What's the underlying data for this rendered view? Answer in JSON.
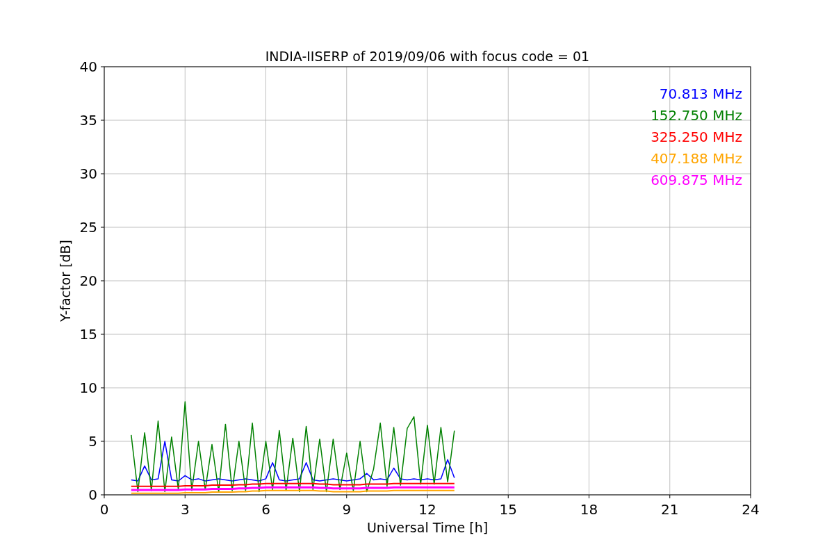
{
  "figure": {
    "chart_data": {
      "type": "line",
      "title": "INDIA-IISERP of 2019/09/06 with focus code = 01",
      "xlabel": "Universal Time [h]",
      "ylabel": "Y-factor [dB]",
      "x": [
        1,
        1.25,
        1.5,
        1.75,
        2,
        2.25,
        2.5,
        2.75,
        3,
        3.25,
        3.5,
        3.75,
        4,
        4.25,
        4.5,
        4.75,
        5,
        5.25,
        5.5,
        5.75,
        6,
        6.25,
        6.5,
        6.75,
        7,
        7.25,
        7.5,
        7.75,
        8,
        8.25,
        8.5,
        8.75,
        9,
        9.25,
        9.5,
        9.75,
        10,
        10.25,
        10.5,
        10.75,
        11,
        11.25,
        11.5,
        11.75,
        12,
        12.25,
        12.5,
        12.75,
        13
      ],
      "series": [
        {
          "name": "70.813 MHz",
          "color": "#0000ff",
          "values": [
            1.4,
            1.3,
            2.7,
            1.4,
            1.5,
            5.0,
            1.4,
            1.3,
            1.8,
            1.4,
            1.5,
            1.3,
            1.4,
            1.5,
            1.4,
            1.3,
            1.4,
            1.5,
            1.4,
            1.3,
            1.5,
            3.0,
            1.4,
            1.3,
            1.4,
            1.5,
            3.0,
            1.4,
            1.3,
            1.4,
            1.5,
            1.4,
            1.3,
            1.4,
            1.5,
            2.0,
            1.4,
            1.5,
            1.4,
            2.5,
            1.5,
            1.4,
            1.5,
            1.4,
            1.5,
            1.4,
            1.5,
            3.3,
            1.6
          ]
        },
        {
          "name": "152.750 MHz",
          "color": "#008000",
          "values": [
            5.6,
            0.3,
            5.8,
            0.4,
            6.9,
            0.3,
            5.4,
            0.5,
            8.7,
            0.4,
            5.0,
            0.5,
            4.7,
            0.3,
            6.6,
            0.4,
            5.0,
            0.4,
            6.7,
            0.3,
            5.0,
            0.5,
            6.0,
            0.4,
            5.3,
            0.3,
            6.4,
            0.5,
            5.2,
            0.3,
            5.2,
            0.5,
            3.9,
            0.4,
            5.0,
            0.3,
            2.4,
            6.7,
            0.8,
            6.3,
            0.9,
            6.2,
            7.3,
            1.0,
            6.5,
            1.0,
            6.3,
            1.2,
            6.0
          ]
        },
        {
          "name": "325.250 MHz",
          "color": "#ff0000",
          "values": [
            0.8,
            0.8,
            0.8,
            0.8,
            0.8,
            0.8,
            0.8,
            0.8,
            0.85,
            0.85,
            0.85,
            0.85,
            0.9,
            0.9,
            0.9,
            0.9,
            0.95,
            0.95,
            1.0,
            1.0,
            1.05,
            1.05,
            1.05,
            1.05,
            1.05,
            1.05,
            1.05,
            1.05,
            1.0,
            1.0,
            0.95,
            0.95,
            0.95,
            0.95,
            0.95,
            1.0,
            1.0,
            1.0,
            1.0,
            1.05,
            1.05,
            1.05,
            1.05,
            1.05,
            1.05,
            1.05,
            1.05,
            1.05,
            1.05
          ]
        },
        {
          "name": "407.188 MHz",
          "color": "#ffa500",
          "values": [
            0.15,
            0.15,
            0.15,
            0.15,
            0.15,
            0.15,
            0.15,
            0.15,
            0.2,
            0.2,
            0.2,
            0.2,
            0.25,
            0.25,
            0.25,
            0.25,
            0.3,
            0.3,
            0.35,
            0.35,
            0.4,
            0.4,
            0.4,
            0.4,
            0.4,
            0.4,
            0.4,
            0.4,
            0.35,
            0.35,
            0.3,
            0.3,
            0.3,
            0.3,
            0.3,
            0.35,
            0.35,
            0.35,
            0.35,
            0.4,
            0.4,
            0.4,
            0.4,
            0.4,
            0.4,
            0.4,
            0.4,
            0.4,
            0.4
          ]
        },
        {
          "name": "609.875 MHz",
          "color": "#ff00ff",
          "values": [
            0.45,
            0.45,
            0.45,
            0.45,
            0.45,
            0.45,
            0.45,
            0.45,
            0.5,
            0.5,
            0.5,
            0.5,
            0.55,
            0.55,
            0.55,
            0.55,
            0.6,
            0.6,
            0.65,
            0.65,
            0.7,
            0.7,
            0.7,
            0.7,
            0.7,
            0.7,
            0.7,
            0.7,
            0.65,
            0.65,
            0.6,
            0.6,
            0.6,
            0.6,
            0.6,
            0.65,
            0.65,
            0.65,
            0.65,
            0.7,
            0.7,
            0.7,
            0.7,
            0.7,
            0.7,
            0.7,
            0.7,
            0.7,
            0.7
          ]
        }
      ],
      "xlim": [
        0,
        24
      ],
      "ylim": [
        0,
        40
      ],
      "grid": true,
      "xticks": [
        0,
        3,
        6,
        9,
        12,
        15,
        18,
        21,
        24
      ],
      "yticks": [
        0,
        5,
        10,
        15,
        20,
        25,
        30,
        35,
        40
      ]
    }
  }
}
